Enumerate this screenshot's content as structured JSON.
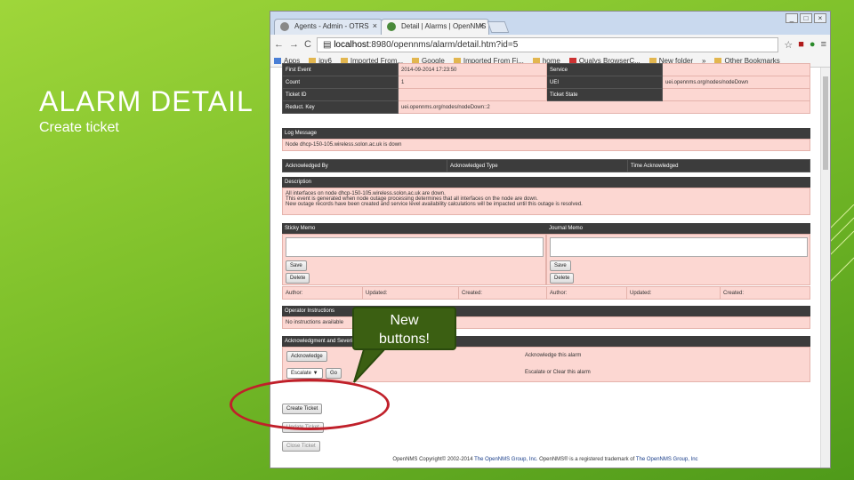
{
  "slide": {
    "title": "ALARM DETAIL",
    "subtitle": "Create ticket"
  },
  "browser": {
    "tabs": [
      "Agents - Admin - OTRS",
      "Detail | Alarms | OpenNMS"
    ],
    "url_host": "localhost",
    "url_rest": ":8980/opennms/alarm/detail.htm?id=5",
    "bookmarks": [
      "Apps",
      "ipv6",
      "Imported From...",
      "Google",
      "Imported From Fi...",
      "home",
      "Qualys BrowserC...",
      "New folder",
      "»",
      "Other Bookmarks"
    ]
  },
  "alarm": {
    "first_event_label": "First Event",
    "first_event_value": "2014-09-2014 17:23:50",
    "service_label": "Service",
    "count_label": "Count",
    "count_value": "1",
    "uei_label": "UEI",
    "uei_value": "uei.opennms.org/nodes/nodeDown",
    "ticket_id_label": "Ticket ID",
    "ticket_state_label": "Ticket State",
    "reduct_key_label": "Reduct. Key",
    "reduct_key_value": "uei.opennms.org/nodes/nodeDown::2",
    "log_message_label": "Log Message",
    "log_message": "Node dhcp-150-105.wireless.solon.ac.uk is down",
    "ack_by_label": "Acknowledged By",
    "ack_type_label": "Acknowledged Type",
    "time_ack_label": "Time Acknowledged",
    "description_label": "Description",
    "description_lines": [
      "All interfaces on node dhcp-150-105.wireless.solon.ac.uk are down.",
      "This event is generated when node outage processing determines that all interfaces on the node are down.",
      "New outage records have been created and service level availability calculations will be impacted until this outage is resolved."
    ],
    "sticky_memo_label": "Sticky Memo",
    "journal_memo_label": "Journal Memo",
    "save_label": "Save",
    "delete_label": "Delete",
    "author_label": "Author:",
    "updated_label": "Updated:",
    "created_label": "Created:",
    "operator_instructions_label": "Operator Instructions",
    "operator_instructions": "No instructions available",
    "ack_section_label": "Acknowledgment and Severity Actions",
    "acknowledge_button": "Acknowledge",
    "acknowledge_desc": "Acknowledge this alarm",
    "severity_select": "Escalate",
    "go_button": "Go",
    "severity_desc": "Escalate or Clear this alarm",
    "create_ticket": "Create Ticket",
    "update_ticket": "Update Ticket",
    "close_ticket": "Close Ticket"
  },
  "footer": {
    "pre": "OpenNMS Copyright© 2002-2014 ",
    "link1": "The OpenNMS Group, Inc.",
    "mid": " OpenNMS® is a registered trademark of ",
    "link2": "The OpenNMS Group, Inc"
  },
  "callout": {
    "line1": "New",
    "line2": "buttons!"
  },
  "colors": {
    "header_bg": "#3c3c3c",
    "row_bg": "#fcd7d2",
    "callout": "#3b5f12",
    "ring": "#c0202a"
  }
}
